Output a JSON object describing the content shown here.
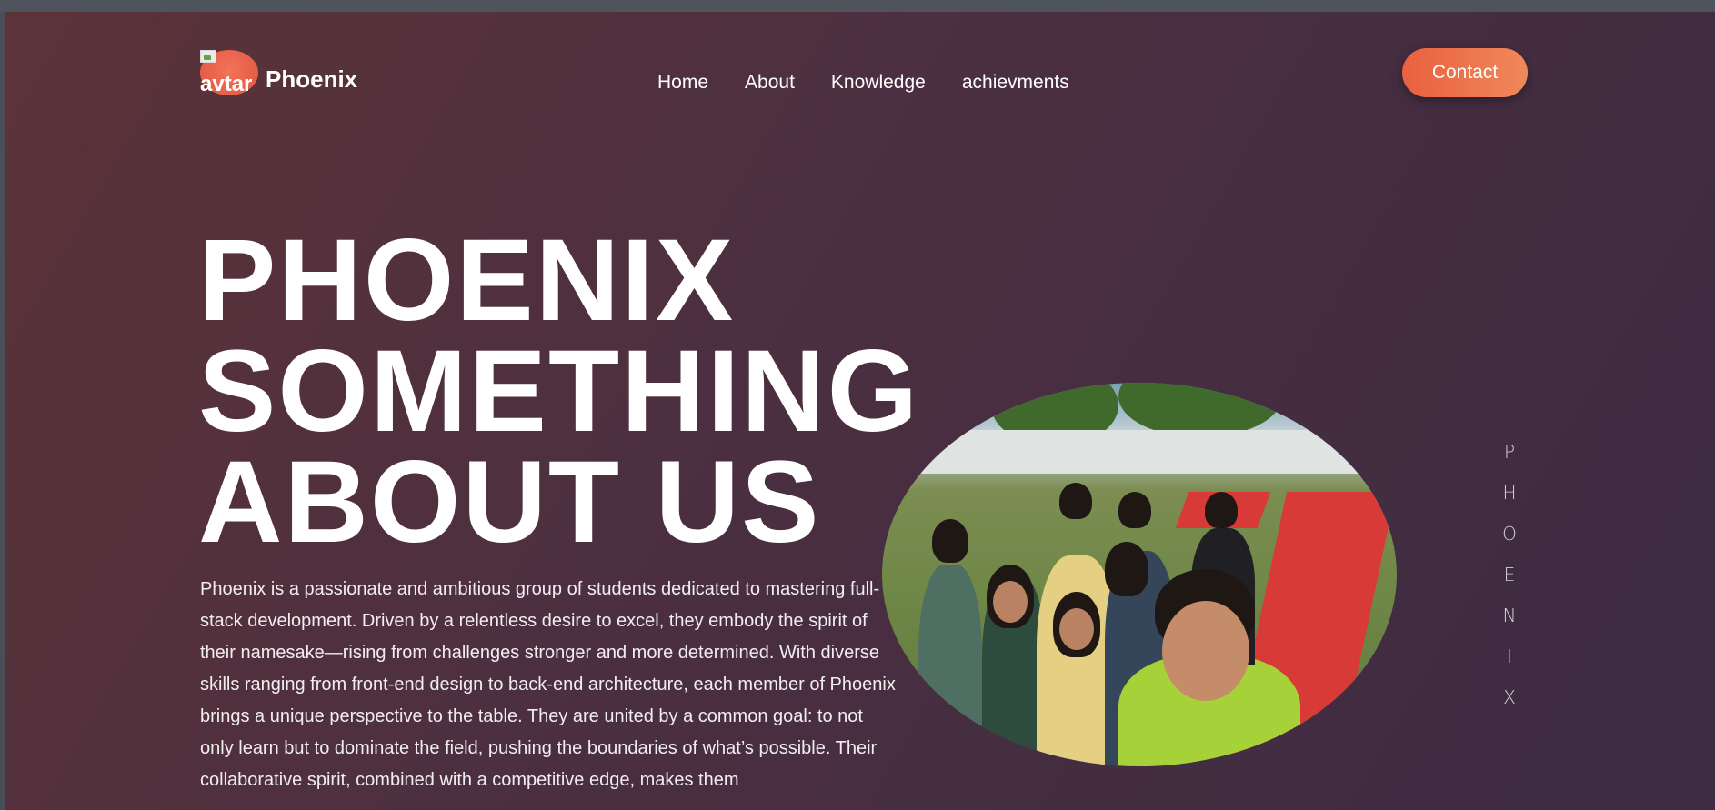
{
  "brand": {
    "logo_alt": "avtar",
    "name": "Phoenix",
    "accent": "#ee7b52"
  },
  "nav": {
    "items": [
      {
        "label": "Home"
      },
      {
        "label": "About"
      },
      {
        "label": "Knowledge"
      },
      {
        "label": "achievments"
      }
    ]
  },
  "header": {
    "contact_label": "Contact"
  },
  "hero": {
    "title_line1": "PHOENIX",
    "title_line2": "SOMETHING",
    "title_line3": "ABOUT US",
    "paragraph": "Phoenix is a passionate and ambitious group of students dedicated to mastering full-stack development. Driven by a relentless desire to excel, they embody the spirit of their namesake—rising from challenges stronger and more determined. With diverse skills ranging from front-end design to back-end architecture, each member of Phoenix brings a unique perspective to the table. They are united by a common goal: to not only learn but to dominate the field, pushing the boundaries of what’s possible. Their collaborative spirit, combined with a competitive edge, makes them"
  },
  "side_text": {
    "letters": [
      "P",
      "H",
      "O",
      "E",
      "N",
      "I",
      "X"
    ]
  },
  "colors": {
    "bg_start": "#5c3338",
    "bg_end": "#3c2b42",
    "button_start": "#e9613f",
    "button_end": "#f0885a"
  }
}
